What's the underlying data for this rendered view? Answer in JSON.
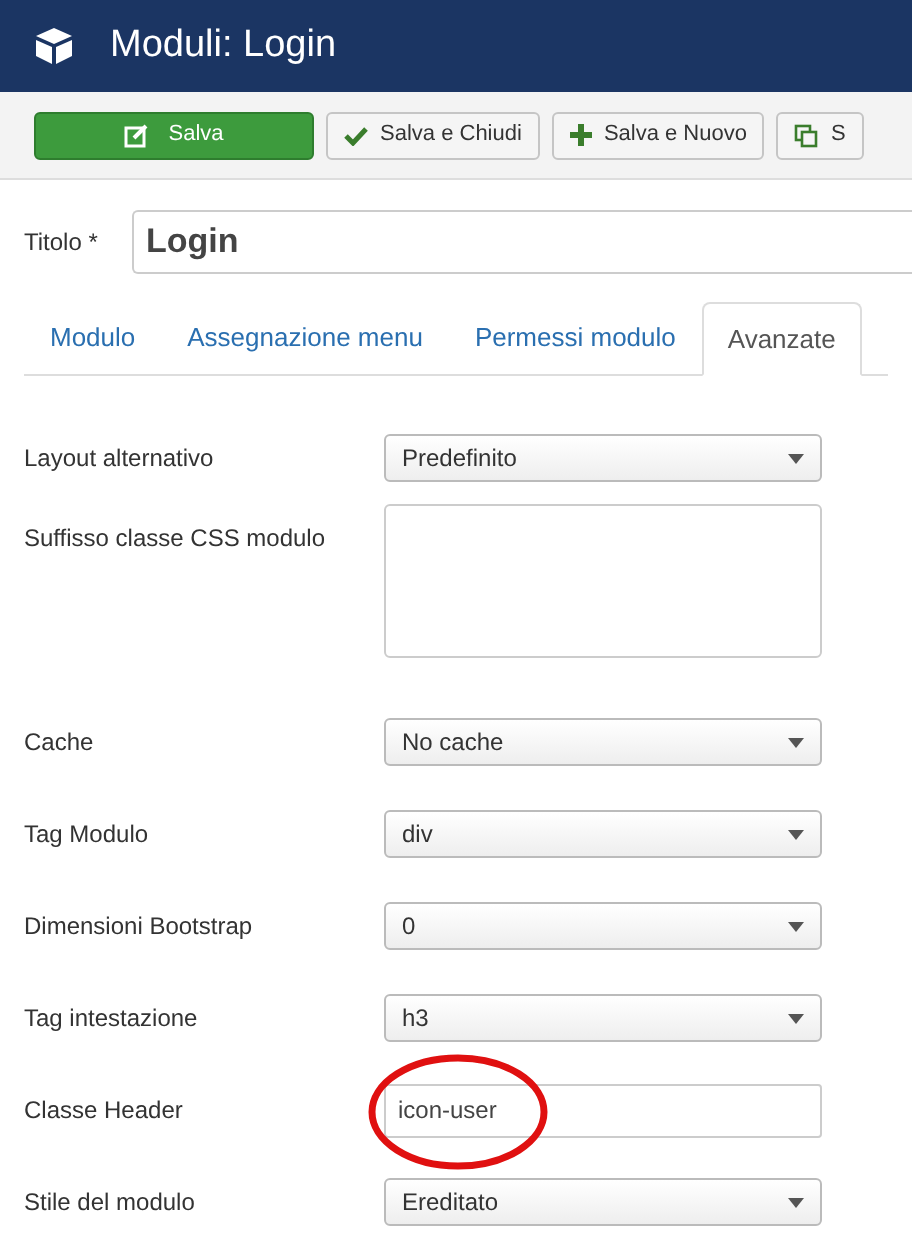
{
  "header": {
    "title": "Moduli: Login"
  },
  "toolbar": [
    {
      "label": "Salva",
      "kind": "primary"
    },
    {
      "label": "Salva e Chiudi",
      "kind": "default"
    },
    {
      "label": "Salva e Nuovo",
      "kind": "default"
    },
    {
      "label": "S",
      "kind": "default"
    }
  ],
  "title_field": {
    "label": "Titolo *",
    "value": "Login"
  },
  "tabs": [
    {
      "label": "Modulo",
      "selected": false
    },
    {
      "label": "Assegnazione menu",
      "selected": false
    },
    {
      "label": "Permessi modulo",
      "selected": false
    },
    {
      "label": "Avanzate",
      "selected": true
    }
  ],
  "fields": [
    {
      "label": "Layout alternativo",
      "kind": "select",
      "value": "Predefinito",
      "highlighted": false
    },
    {
      "label": "Suffisso classe CSS modulo",
      "kind": "textarea",
      "highlighted": false
    },
    {
      "label": "Cache",
      "kind": "select",
      "value": "No cache",
      "highlighted": false
    },
    {
      "label": "Tag Modulo",
      "kind": "select",
      "value": "div",
      "highlighted": false
    },
    {
      "label": "Dimensioni Bootstrap",
      "kind": "select",
      "value": "0",
      "highlighted": false
    },
    {
      "label": "Tag intestazione",
      "kind": "select",
      "value": "h3",
      "highlighted": false
    },
    {
      "label": "Classe Header",
      "kind": "text",
      "value": "icon-user",
      "highlighted": true
    },
    {
      "label": "Stile del modulo",
      "kind": "select",
      "value": "Ereditato",
      "highlighted": false
    }
  ]
}
